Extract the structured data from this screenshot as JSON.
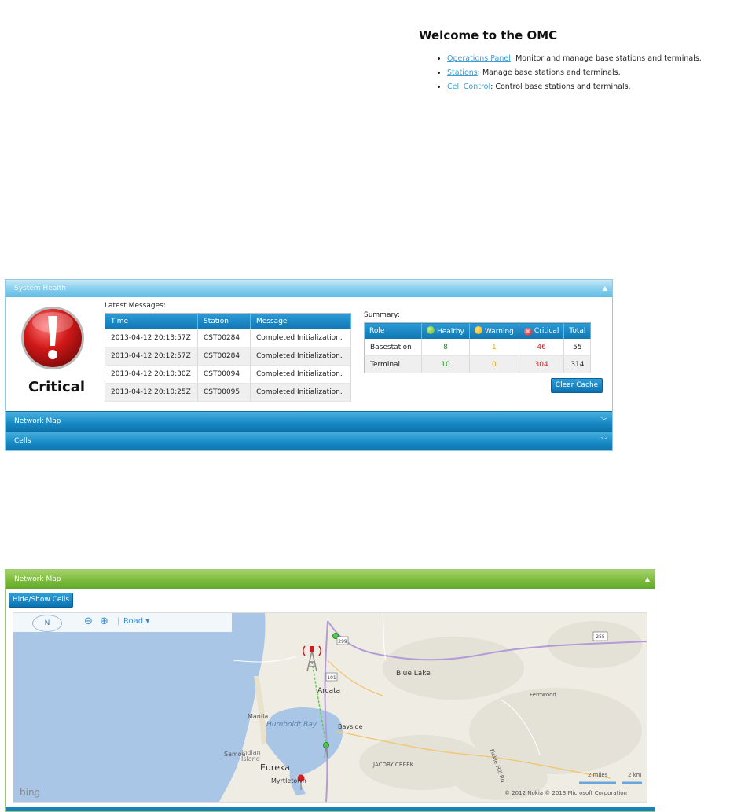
{
  "welcome": {
    "title": "Welcome to the OMC",
    "items": [
      {
        "link": "Operations Panel",
        "desc": ": Monitor and manage base stations and terminals."
      },
      {
        "link": "Stations",
        "desc": ": Manage base stations and terminals."
      },
      {
        "link": "Cell Control",
        "desc": ": Control base stations and terminals."
      }
    ]
  },
  "health": {
    "header": "System Health",
    "status": "Critical",
    "latest_label": "Latest Messages:",
    "columns": [
      "Time",
      "Station",
      "Message"
    ],
    "rows": [
      [
        "2013-04-12 20:13:57Z",
        "CST00284",
        "Completed Initialization."
      ],
      [
        "2013-04-12 20:12:57Z",
        "CST00284",
        "Completed Initialization."
      ],
      [
        "2013-04-12 20:10:30Z",
        "CST00094",
        "Completed Initialization."
      ],
      [
        "2013-04-12 20:10:25Z",
        "CST00095",
        "Completed Initialization."
      ]
    ],
    "summary_label": "Summary:",
    "summary_columns": [
      "Role",
      "Healthy",
      "Warning",
      "Critical",
      "Total"
    ],
    "summary_rows": [
      [
        "Basestation",
        "8",
        "1",
        "46",
        "55"
      ],
      [
        "Terminal",
        "10",
        "0",
        "304",
        "314"
      ]
    ],
    "clear_cache": "Clear Cache"
  },
  "panels": {
    "network_map": "Network Map",
    "cells": "Cells"
  },
  "map": {
    "header": "Network Map",
    "hide_show": "Hide/Show Cells",
    "compass": "N",
    "road": "Road",
    "bing": "bing",
    "copyright": "© 2012 Nokia   © 2013 Microsoft Corporation",
    "scale_miles": "2 miles",
    "scale_km": "2 km",
    "places": {
      "blue_lake": "Blue Lake",
      "arcata": "Arcata",
      "humboldt_bay": "Humboldt Bay",
      "bayside": "Bayside",
      "eureka": "Eureka",
      "myrtletown": "Myrtletown",
      "manila": "Manila",
      "samoa": "Samoa",
      "indian_island": "Indian Island",
      "jacoby_creek": "JACOBY CREEK",
      "fernwood": "Fernwood",
      "fickle_hill": "Fickle Hill Rd",
      "route_299": "299",
      "route_101": "101",
      "route_255": "255"
    }
  },
  "colors": {
    "accent_blue": "#1a8cc7",
    "map_green": "#7fbd3f",
    "critical_red": "#d42020"
  }
}
